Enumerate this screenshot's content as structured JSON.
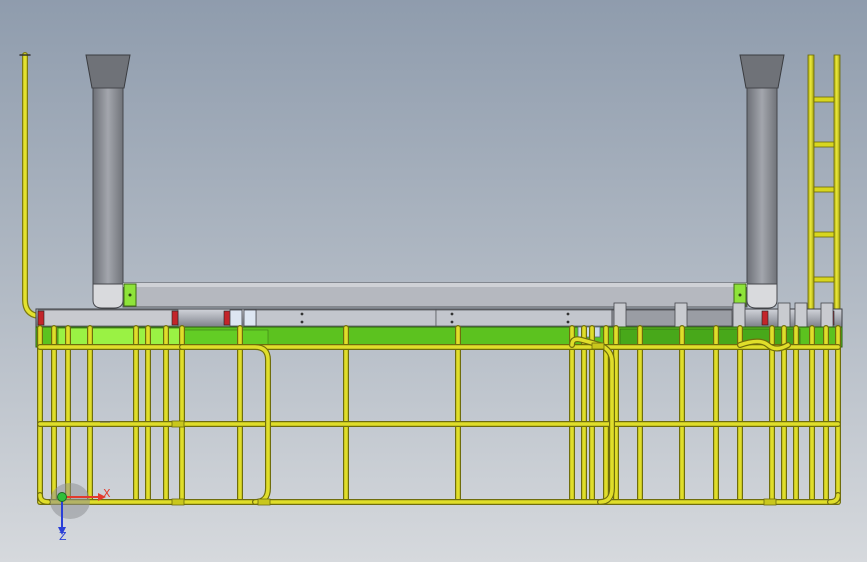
{
  "viewport": {
    "background_top": "#8f9cad",
    "background_bottom": "#d6d9dd"
  },
  "triad": {
    "x_label": "X",
    "z_label": "Z",
    "x_color": "#e33a2c",
    "y_color": "#2fbf3a",
    "z_color": "#2a3fd8"
  },
  "colors": {
    "rail": "#d8d61f",
    "rail_dark": "#7c7a10",
    "deck": "#4fc41a",
    "deck_light": "#8ef03a",
    "beam": "#b9bcc4",
    "column": "#8d8f96",
    "marker_red": "#c3252a",
    "marker_blue": "#2d5fd6"
  }
}
